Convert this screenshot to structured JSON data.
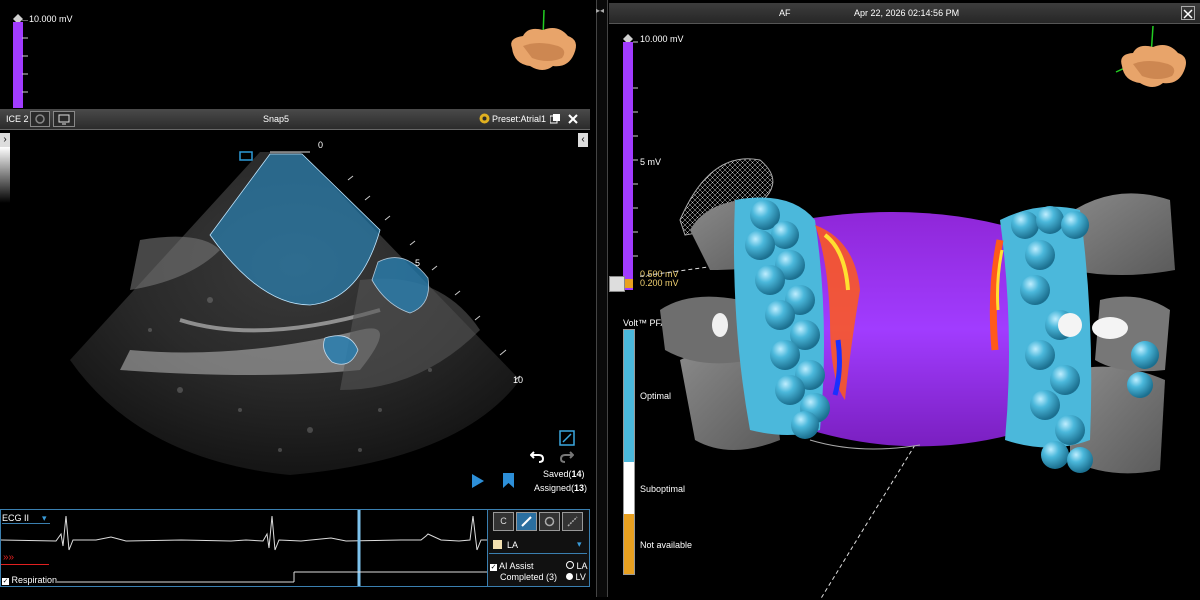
{
  "left_scale": {
    "max_label": "10.000 mV",
    "color": "#a13cff"
  },
  "ice_panel": {
    "title": "ICE 2",
    "snapshot_name": "Snap5",
    "preset_label": "Preset:Atrial1",
    "depth_marks": [
      "0",
      "5",
      "10"
    ],
    "saved_label": "Saved(",
    "saved_count": "14",
    "saved_close": ")",
    "assigned_label": "Assigned(",
    "assigned_count": "13",
    "assigned_close": ")"
  },
  "ecg": {
    "lead_label": "ECG II",
    "respiration_label": "Respiration",
    "respiration_checked": true
  },
  "tools": {
    "c_label": "C",
    "structure_label": "LA",
    "ai_assist_label": "AI Assist",
    "completed_label": "Completed (3)",
    "radio_la": "LA",
    "radio_lv": "LV"
  },
  "map_panel": {
    "rhythm": "AF",
    "datetime": "Apr 22, 2026 02:14:56 PM",
    "scale_max": "10.000 mV",
    "scale_mid": "5 mV",
    "scale_high": "0.500 mV",
    "scale_low": "0.200 mV",
    "legend_title": "Volt™ PFA",
    "legend_items": [
      "Optimal",
      "Suboptimal",
      "Not available"
    ],
    "colors": {
      "optimal": "#4bb8db",
      "suboptimal": "#ffffff",
      "na": "#e8a020",
      "voltage": "#9b2fe8"
    }
  }
}
